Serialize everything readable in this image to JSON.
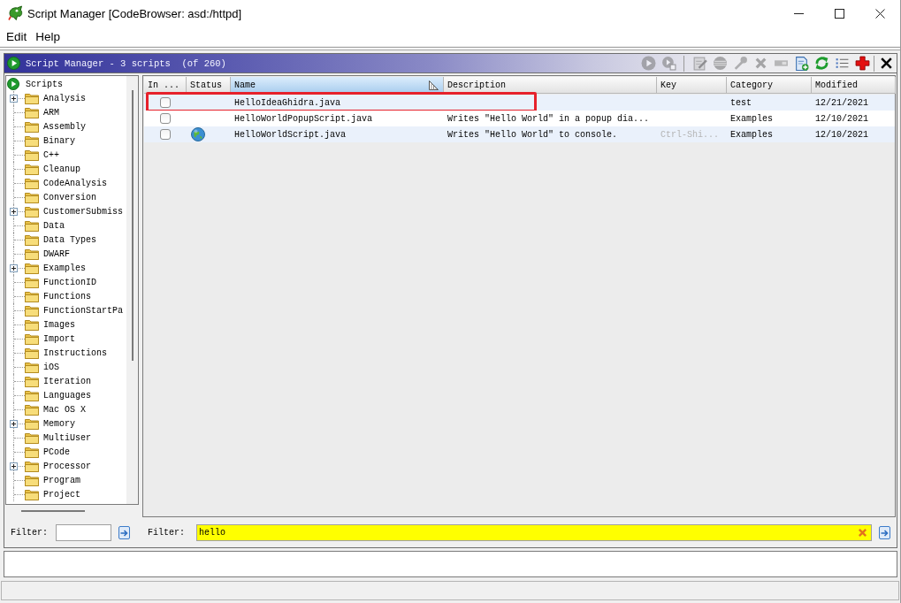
{
  "window": {
    "title": "Script Manager [CodeBrowser: asd:/httpd]"
  },
  "menu": [
    {
      "label": "Edit"
    },
    {
      "label": "Help"
    }
  ],
  "panel": {
    "title": "Script Manager - 3 scripts  (of 260)",
    "tools": [
      {
        "disabled": true
      },
      {
        "disabled": true
      },
      {
        "disabled": true
      },
      {
        "disabled": true
      },
      {
        "disabled": true
      },
      {
        "disabled": true
      },
      {
        "disabled": true
      },
      {
        "disabled": false
      },
      {
        "disabled": false
      },
      {
        "disabled": false
      },
      {
        "disabled": false
      },
      {
        "disabled": false
      }
    ]
  },
  "tree": {
    "root": "Scripts",
    "items": [
      {
        "label": "Analysis",
        "has_children": true
      },
      {
        "label": "ARM",
        "has_children": false
      },
      {
        "label": "Assembly",
        "has_children": false
      },
      {
        "label": "Binary",
        "has_children": false
      },
      {
        "label": "C++",
        "has_children": false
      },
      {
        "label": "Cleanup",
        "has_children": false
      },
      {
        "label": "CodeAnalysis",
        "has_children": false
      },
      {
        "label": "Conversion",
        "has_children": false
      },
      {
        "label": "CustomerSubmiss",
        "has_children": true
      },
      {
        "label": "Data",
        "has_children": false
      },
      {
        "label": "Data Types",
        "has_children": false
      },
      {
        "label": "DWARF",
        "has_children": false
      },
      {
        "label": "Examples",
        "has_children": true
      },
      {
        "label": "FunctionID",
        "has_children": false
      },
      {
        "label": "Functions",
        "has_children": false
      },
      {
        "label": "FunctionStartPa",
        "has_children": false
      },
      {
        "label": "Images",
        "has_children": false
      },
      {
        "label": "Import",
        "has_children": false
      },
      {
        "label": "Instructions",
        "has_children": false
      },
      {
        "label": "iOS",
        "has_children": false
      },
      {
        "label": "Iteration",
        "has_children": false
      },
      {
        "label": "Languages",
        "has_children": false
      },
      {
        "label": "Mac OS X",
        "has_children": false
      },
      {
        "label": "Memory",
        "has_children": true
      },
      {
        "label": "MultiUser",
        "has_children": false
      },
      {
        "label": "PCode",
        "has_children": false
      },
      {
        "label": "Processor",
        "has_children": true
      },
      {
        "label": "Program",
        "has_children": false
      },
      {
        "label": "Project",
        "has_children": false
      }
    ]
  },
  "tree_filter": {
    "label": "Filter:",
    "highlighted": false
  },
  "table": {
    "columns": [
      {
        "label": "In ...",
        "sorted": false
      },
      {
        "label": "Status",
        "sorted": false
      },
      {
        "label": "Name",
        "sorted": true
      },
      {
        "label": "Description",
        "sorted": false
      },
      {
        "label": "Key",
        "sorted": false
      },
      {
        "label": "Category",
        "sorted": false
      },
      {
        "label": "Modified",
        "sorted": false
      }
    ],
    "rows": [
      {
        "in_tool": false,
        "status_icon": false,
        "name": "HelloIdeaGhidra.java",
        "category": "test",
        "modified": "12/21/2021",
        "annotated": true
      },
      {
        "in_tool": false,
        "status_icon": false,
        "name": "HelloWorldPopupScript.java",
        "description": "Writes \"Hello World\" in a popup dia...",
        "category": "Examples",
        "modified": "12/10/2021",
        "annotated": false
      },
      {
        "in_tool": false,
        "status_icon": true,
        "name": "HelloWorldScript.java",
        "description": "Writes \"Hello World\" to console.",
        "key": "Ctrl-Shi...",
        "category": "Examples",
        "modified": "12/10/2021",
        "annotated": false
      }
    ]
  },
  "table_filter": {
    "label": "Filter:",
    "value": "hello",
    "highlighted": true
  }
}
